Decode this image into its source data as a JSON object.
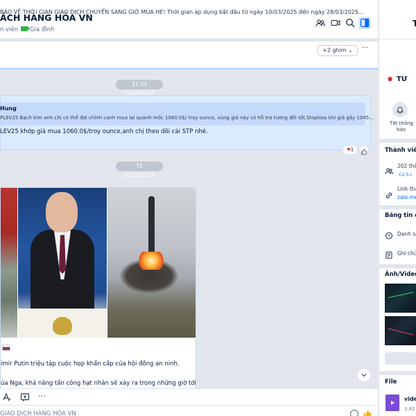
{
  "header": {
    "title": "ÁCH HÀNG HÓA VN",
    "member_label": "n viên",
    "tag_label": "Gia đình"
  },
  "pin": {
    "text": "BÁO VỀ THỜI GIAN GIAO DỊCH CHUYỂN SANG GIỜ MÙA HÈ! Thời gian áp dụng bắt đầu từ ngày 10/03/2025 đến ngày 28/03/2025...",
    "more_label": "+2 ghim ⌄",
    "overflow_label": "···"
  },
  "messages": [
    {
      "date": "21:33 30/05/2025",
      "quote_author": "Hung",
      "quote_text": "PLEV25 Bạch kim anh chị có thể đợi chỉnh canh mua lại quanh mốc 1060.0$/ troy ounce, vùng giá này có hỗ trợ tương đối tốt.Stoploss khi giá gãy 1045...",
      "text": "LEV25 khớp giá mua 1060.0$/troy ounce,anh chị theo dõi cài STP nhé.",
      "reaction_count": "1"
    },
    {
      "date": "T2 02/06/2025",
      "line1": "imir Putin triệu tập cuộc họp khẩn cấp của hội đồng an ninh.",
      "line2": "ủa Nga, khả năng tấn công hạt nhân sẽ xảy ra trong những giờ tới."
    }
  ],
  "composer": {
    "placeholder": "GIAO DỊCH HÀNG HÓA VN"
  },
  "sidebar": {
    "title": "T",
    "group_name": "TƯ",
    "notify_label_1": "Tắt thông",
    "notify_label_2": "báo",
    "members_heading": "Thành viê",
    "members_count": "202 thà",
    "members_sub": "Có 5 r",
    "link_label": "Link tha",
    "link_url": "zalo.me",
    "board_heading": "Bảng tin c",
    "board_item1": "Danh sá",
    "board_item2": "Ghi chú",
    "media_heading": "Ảnh/Video",
    "file_heading": "File",
    "file_name": "vide",
    "file_size": "3.42"
  },
  "colors": {
    "accent": "#0068ff",
    "quote_bg": "#c5dafb",
    "message_bg": "#dbebff"
  }
}
